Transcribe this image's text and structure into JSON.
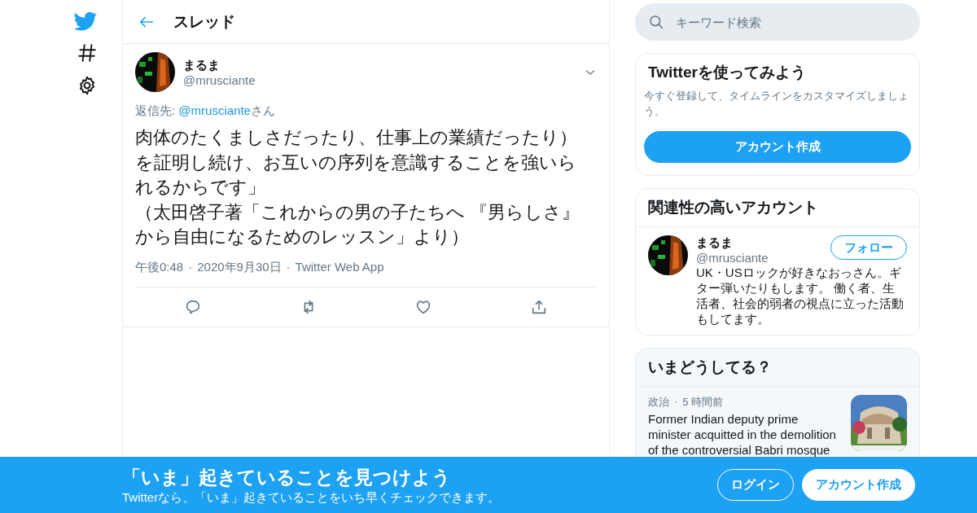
{
  "header": {
    "title": "スレッド"
  },
  "tweet": {
    "name": "まるま",
    "handle": "@mrusciante",
    "reply_label": "返信先: ",
    "reply_to": "@mrusciante",
    "reply_suffix": "さん",
    "paragraphs": [
      "肉体のたくましさだったり、仕事上の業績だったり）を証明し続け、お互いの序列を意識することを強いられるからです」",
      "（太田啓子著「これからの男の子たちへ 『男らしさ』から自由になるためのレッスン」より）"
    ],
    "time": "午後0:48",
    "separator": "·",
    "date": "2020年9月30日",
    "source": "Twitter Web App"
  },
  "search": {
    "placeholder": "キーワード検索"
  },
  "signup_card": {
    "title": "Twitterを使ってみよう",
    "text": "今すぐ登録して、タイムラインをカスタマイズしましょう。",
    "button": "アカウント作成"
  },
  "related_card": {
    "title": "関連性の高いアカウント",
    "accounts": [
      {
        "name": "まるま",
        "handle": "@mrusciante",
        "follow": "フォロー",
        "bio": "UK・USロックが好きなおっさん。ギター弾いたりもします。 働く者、生活者、社会的弱者の視点に立った活動もしてます。"
      }
    ]
  },
  "trends_card": {
    "title": "いまどうしてる？",
    "items": [
      {
        "category": "政治",
        "separator": "·",
        "age": "5 時間前",
        "headline": "Former Indian deputy prime minister acquitted in the demolition of the controversial Babri mosque",
        "kind": "picture"
      }
    ]
  },
  "banner": {
    "title": "「いま」起きていることを見つけよう",
    "subtitle": "Twitterなら、「いま」起きていることをいち早くチェックできます。",
    "buttons": [
      {
        "label": "ログイン",
        "kind": "outline"
      },
      {
        "label": "アカウント作成",
        "kind": "solid"
      }
    ]
  }
}
